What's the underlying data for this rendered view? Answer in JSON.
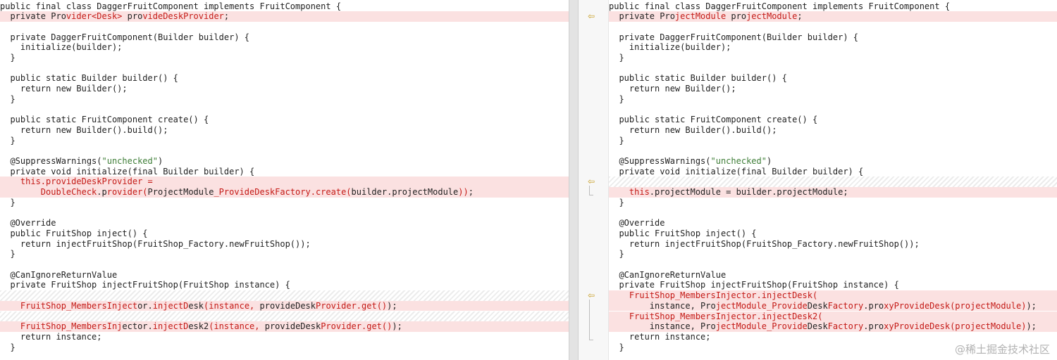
{
  "left_lines": [
    {
      "kind": "normal",
      "segs": [
        {
          "t": "public final class DaggerFruitComponent implements FruitComponent {",
          "c": "txt"
        }
      ]
    },
    {
      "kind": "changed",
      "segs": [
        {
          "t": "  private Pro",
          "c": "txt"
        },
        {
          "t": "vider<Desk>",
          "c": "del"
        },
        {
          "t": " pro",
          "c": "txt"
        },
        {
          "t": "videDeskProvider",
          "c": "del"
        },
        {
          "t": ";",
          "c": "txt"
        }
      ]
    },
    {
      "kind": "normal",
      "segs": []
    },
    {
      "kind": "normal",
      "segs": [
        {
          "t": "  private DaggerFruitComponent(Builder builder) {",
          "c": "txt"
        }
      ]
    },
    {
      "kind": "normal",
      "segs": [
        {
          "t": "    initialize(builder);",
          "c": "txt"
        }
      ]
    },
    {
      "kind": "normal",
      "segs": [
        {
          "t": "  }",
          "c": "txt"
        }
      ]
    },
    {
      "kind": "normal",
      "segs": []
    },
    {
      "kind": "normal",
      "segs": [
        {
          "t": "  public static Builder builder() {",
          "c": "txt"
        }
      ]
    },
    {
      "kind": "normal",
      "segs": [
        {
          "t": "    return new Builder();",
          "c": "txt"
        }
      ]
    },
    {
      "kind": "normal",
      "segs": [
        {
          "t": "  }",
          "c": "txt"
        }
      ]
    },
    {
      "kind": "normal",
      "segs": []
    },
    {
      "kind": "normal",
      "segs": [
        {
          "t": "  public static FruitComponent create() {",
          "c": "txt"
        }
      ]
    },
    {
      "kind": "normal",
      "segs": [
        {
          "t": "    return new Builder().build();",
          "c": "txt"
        }
      ]
    },
    {
      "kind": "normal",
      "segs": [
        {
          "t": "  }",
          "c": "txt"
        }
      ]
    },
    {
      "kind": "normal",
      "segs": []
    },
    {
      "kind": "normal",
      "segs": [
        {
          "t": "  @SuppressWarnings(",
          "c": "txt"
        },
        {
          "t": "\"unchecked\"",
          "c": "str"
        },
        {
          "t": ")",
          "c": "txt"
        }
      ]
    },
    {
      "kind": "normal",
      "segs": [
        {
          "t": "  private void initialize(final Builder builder) {",
          "c": "txt"
        }
      ]
    },
    {
      "kind": "changed",
      "segs": [
        {
          "t": "    this.provideDeskProvider =",
          "c": "del"
        }
      ]
    },
    {
      "kind": "changed",
      "segs": [
        {
          "t": "        DoubleCheck",
          "c": "del"
        },
        {
          "t": ".p",
          "c": "txt"
        },
        {
          "t": "rovider(",
          "c": "del"
        },
        {
          "t": "ProjectModule",
          "c": "txt"
        },
        {
          "t": "_ProvideDeskFactory.create(",
          "c": "del"
        },
        {
          "t": "builder.projectModule",
          "c": "txt"
        },
        {
          "t": "))",
          "c": "del"
        },
        {
          "t": ";",
          "c": "txt"
        }
      ]
    },
    {
      "kind": "normal",
      "segs": [
        {
          "t": "  }",
          "c": "txt"
        }
      ]
    },
    {
      "kind": "normal",
      "segs": []
    },
    {
      "kind": "normal",
      "segs": [
        {
          "t": "  @Override",
          "c": "txt"
        }
      ]
    },
    {
      "kind": "normal",
      "segs": [
        {
          "t": "  public FruitShop inject() {",
          "c": "txt"
        }
      ]
    },
    {
      "kind": "normal",
      "segs": [
        {
          "t": "    return injectFruitShop(FruitShop_Factory.newFruitShop());",
          "c": "txt"
        }
      ]
    },
    {
      "kind": "normal",
      "segs": [
        {
          "t": "  }",
          "c": "txt"
        }
      ]
    },
    {
      "kind": "normal",
      "segs": []
    },
    {
      "kind": "normal",
      "segs": [
        {
          "t": "  @CanIgnoreReturnValue",
          "c": "txt"
        }
      ]
    },
    {
      "kind": "normal",
      "segs": [
        {
          "t": "  private FruitShop injectFruitShop(FruitShop instance) {",
          "c": "txt"
        }
      ]
    },
    {
      "kind": "gap",
      "segs": []
    },
    {
      "kind": "changed",
      "segs": [
        {
          "t": "    FruitShop_MembersInject",
          "c": "del"
        },
        {
          "t": "or.",
          "c": "txt"
        },
        {
          "t": "injectD",
          "c": "del"
        },
        {
          "t": "esk",
          "c": "txt"
        },
        {
          "t": "(instance, ",
          "c": "del"
        },
        {
          "t": "provideDesk",
          "c": "txt"
        },
        {
          "t": "Provider.get()",
          "c": "del"
        },
        {
          "t": ");",
          "c": "txt"
        }
      ]
    },
    {
      "kind": "gap",
      "segs": []
    },
    {
      "kind": "changed",
      "segs": [
        {
          "t": "    FruitShop_MembersInj",
          "c": "del"
        },
        {
          "t": "ector.",
          "c": "txt"
        },
        {
          "t": "injectD",
          "c": "del"
        },
        {
          "t": "esk2",
          "c": "txt"
        },
        {
          "t": "(instance, ",
          "c": "del"
        },
        {
          "t": "provideDesk",
          "c": "txt"
        },
        {
          "t": "Provider.get()",
          "c": "del"
        },
        {
          "t": ");",
          "c": "txt"
        }
      ]
    },
    {
      "kind": "normal",
      "segs": [
        {
          "t": "    return instance;",
          "c": "txt"
        }
      ]
    },
    {
      "kind": "normal",
      "segs": [
        {
          "t": "  }",
          "c": "txt"
        }
      ]
    }
  ],
  "right_lines": [
    {
      "kind": "normal",
      "segs": [
        {
          "t": "public final class DaggerFruitComponent implements FruitComponent {",
          "c": "txt"
        }
      ]
    },
    {
      "kind": "changed",
      "segs": [
        {
          "t": "  private Pro",
          "c": "txt"
        },
        {
          "t": "jectModule",
          "c": "del"
        },
        {
          "t": " pro",
          "c": "txt"
        },
        {
          "t": "jectModule",
          "c": "del"
        },
        {
          "t": ";",
          "c": "txt"
        }
      ]
    },
    {
      "kind": "normal",
      "segs": []
    },
    {
      "kind": "normal",
      "segs": [
        {
          "t": "  private DaggerFruitComponent(Builder builder) {",
          "c": "txt"
        }
      ]
    },
    {
      "kind": "normal",
      "segs": [
        {
          "t": "    initialize(builder);",
          "c": "txt"
        }
      ]
    },
    {
      "kind": "normal",
      "segs": [
        {
          "t": "  }",
          "c": "txt"
        }
      ]
    },
    {
      "kind": "normal",
      "segs": []
    },
    {
      "kind": "normal",
      "segs": [
        {
          "t": "  public static Builder builder() {",
          "c": "txt"
        }
      ]
    },
    {
      "kind": "normal",
      "segs": [
        {
          "t": "    return new Builder();",
          "c": "txt"
        }
      ]
    },
    {
      "kind": "normal",
      "segs": [
        {
          "t": "  }",
          "c": "txt"
        }
      ]
    },
    {
      "kind": "normal",
      "segs": []
    },
    {
      "kind": "normal",
      "segs": [
        {
          "t": "  public static FruitComponent create() {",
          "c": "txt"
        }
      ]
    },
    {
      "kind": "normal",
      "segs": [
        {
          "t": "    return new Builder().build();",
          "c": "txt"
        }
      ]
    },
    {
      "kind": "normal",
      "segs": [
        {
          "t": "  }",
          "c": "txt"
        }
      ]
    },
    {
      "kind": "normal",
      "segs": []
    },
    {
      "kind": "normal",
      "segs": [
        {
          "t": "  @SuppressWarnings(",
          "c": "txt"
        },
        {
          "t": "\"unchecked\"",
          "c": "str"
        },
        {
          "t": ")",
          "c": "txt"
        }
      ]
    },
    {
      "kind": "normal",
      "segs": [
        {
          "t": "  private void initialize(final Builder builder) {",
          "c": "txt"
        }
      ]
    },
    {
      "kind": "gap",
      "segs": []
    },
    {
      "kind": "changed",
      "segs": [
        {
          "t": "    this",
          "c": "del"
        },
        {
          "t": ".projectModule = builder.projectModule;",
          "c": "txt"
        }
      ]
    },
    {
      "kind": "normal",
      "segs": [
        {
          "t": "  }",
          "c": "txt"
        }
      ]
    },
    {
      "kind": "normal",
      "segs": []
    },
    {
      "kind": "normal",
      "segs": [
        {
          "t": "  @Override",
          "c": "txt"
        }
      ]
    },
    {
      "kind": "normal",
      "segs": [
        {
          "t": "  public FruitShop inject() {",
          "c": "txt"
        }
      ]
    },
    {
      "kind": "normal",
      "segs": [
        {
          "t": "    return injectFruitShop(FruitShop_Factory.newFruitShop());",
          "c": "txt"
        }
      ]
    },
    {
      "kind": "normal",
      "segs": [
        {
          "t": "  }",
          "c": "txt"
        }
      ]
    },
    {
      "kind": "normal",
      "segs": []
    },
    {
      "kind": "normal",
      "segs": [
        {
          "t": "  @CanIgnoreReturnValue",
          "c": "txt"
        }
      ]
    },
    {
      "kind": "normal",
      "segs": [
        {
          "t": "  private FruitShop injectFruitShop(FruitShop instance) {",
          "c": "txt"
        }
      ]
    },
    {
      "kind": "changed",
      "segs": [
        {
          "t": "    FruitShop_MembersInjector.injectDesk(",
          "c": "del"
        }
      ]
    },
    {
      "kind": "changed",
      "segs": [
        {
          "t": "        instance, Pro",
          "c": "txt"
        },
        {
          "t": "jectModule_Provide",
          "c": "del"
        },
        {
          "t": "Desk",
          "c": "txt"
        },
        {
          "t": "Factory",
          "c": "del"
        },
        {
          "t": ".pro",
          "c": "txt"
        },
        {
          "t": "xyProvideDesk(projectModule)",
          "c": "del"
        },
        {
          "t": ");",
          "c": "txt"
        }
      ]
    },
    {
      "kind": "changed",
      "segs": [
        {
          "t": "    FruitShop_MembersInjector.injectDesk2(",
          "c": "del"
        }
      ]
    },
    {
      "kind": "changed",
      "segs": [
        {
          "t": "        instance, Pro",
          "c": "txt"
        },
        {
          "t": "jectModule_Provide",
          "c": "del"
        },
        {
          "t": "Desk",
          "c": "txt"
        },
        {
          "t": "Factory",
          "c": "del"
        },
        {
          "t": ".pro",
          "c": "txt"
        },
        {
          "t": "xyProvideDesk(projectModule)",
          "c": "del"
        },
        {
          "t": ");",
          "c": "txt"
        }
      ]
    },
    {
      "kind": "normal",
      "segs": [
        {
          "t": "    return instance;",
          "c": "txt"
        }
      ]
    },
    {
      "kind": "normal",
      "segs": [
        {
          "t": "  }",
          "c": "txt"
        }
      ]
    }
  ],
  "gutter": {
    "arrow_glyph": "⇦",
    "arrow_rows": [
      1,
      17,
      28
    ],
    "arrow_color": "#c9a02a"
  },
  "colors": {
    "changed_background": "#fbe1e1",
    "changed_text": "#c41a16",
    "string_literal": "#3d7d36"
  },
  "watermark": "@稀土掘金技术社区"
}
